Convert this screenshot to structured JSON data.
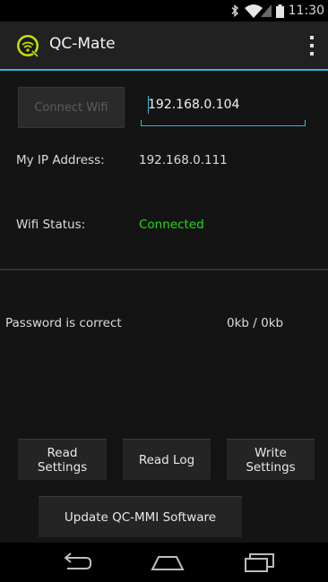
{
  "status_bar": {
    "time": "11:30",
    "icons": [
      "bluetooth-icon",
      "wifi-icon",
      "signal-icon",
      "battery-icon"
    ]
  },
  "action_bar": {
    "title": "QC-Mate",
    "logo": "qc-mate-logo",
    "menu_icon": "overflow-menu-icon",
    "accent_color": "#33b5e5"
  },
  "connection": {
    "connect_button_label": "Connect Wifi",
    "ip_input_value": "192.168.0.104"
  },
  "info": {
    "my_ip_label": "My IP Address:",
    "my_ip_value": "192.168.0.111",
    "wifi_status_label": "Wifi Status:",
    "wifi_status_value": "Connected",
    "wifi_status_color": "#22dd11"
  },
  "transfer": {
    "message": "Password is correct",
    "progress": "0kb / 0kb"
  },
  "actions": {
    "read_settings_label": "Read Settings",
    "read_log_label": "Read Log",
    "write_settings_label": "Write Settings",
    "update_label": "Update QC-MMI Software"
  },
  "nav_bar": {
    "icons": [
      "back-icon",
      "home-icon",
      "recents-icon"
    ]
  }
}
